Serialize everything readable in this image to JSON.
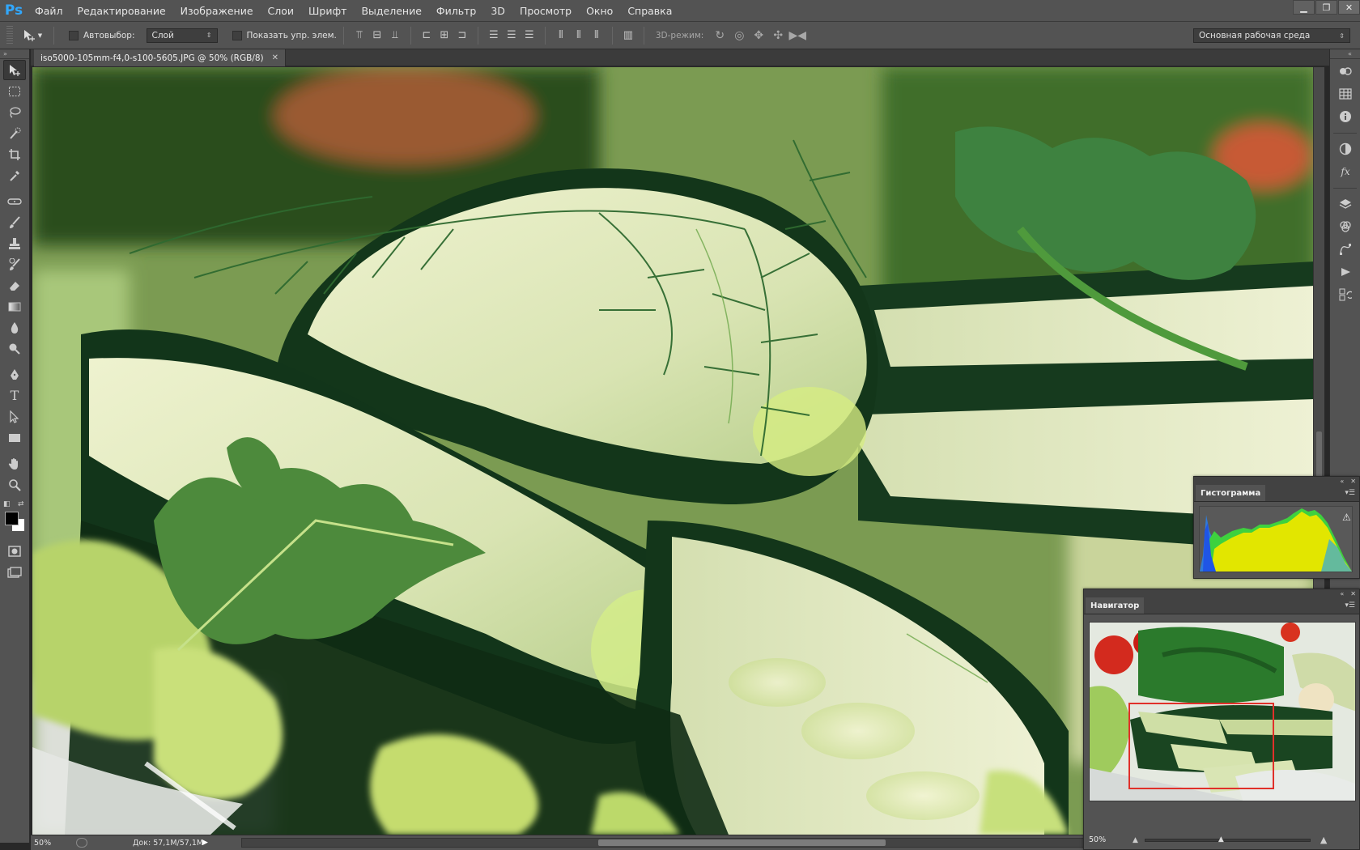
{
  "app": {
    "logo": "Ps"
  },
  "menu": [
    "Файл",
    "Редактирование",
    "Изображение",
    "Слои",
    "Шрифт",
    "Выделение",
    "Фильтр",
    "3D",
    "Просмотр",
    "Окно",
    "Справка"
  ],
  "window_controls": {
    "minimize": "▁",
    "restore": "❐",
    "close": "✕"
  },
  "options": {
    "move_tool_icon": "move-tool-icon",
    "auto_select_label": "Автовыбор:",
    "auto_select_value": "Слой",
    "show_transform_label": "Показать упр. элем.",
    "mode_3d_label": "3D-режим:",
    "workspace_value": "Основная рабочая среда"
  },
  "document": {
    "tab_title": "iso5000-105mm-f4,0-s100-5605.JPG @ 50% (RGB/8)",
    "close_glyph": "✕"
  },
  "status": {
    "zoom": "50%",
    "doc_size": "Док: 57,1M/57,1M",
    "arrow": "▶"
  },
  "histogram_panel": {
    "title": "Гистограмма",
    "warning_glyph": "⚠"
  },
  "navigator_panel": {
    "title": "Навигатор",
    "zoom": "50%",
    "view_rect_color": "#e0302a"
  },
  "colors": {
    "ui_bg": "#535353",
    "workspace_bg": "#282828",
    "foreground": "#000000",
    "background": "#ffffff"
  },
  "icons": {
    "toolbox": [
      "move-tool-icon",
      "marquee-tool-icon",
      "lasso-tool-icon",
      "quick-selection-tool-icon",
      "crop-tool-icon",
      "eyedropper-tool-icon",
      "healing-brush-tool-icon",
      "brush-tool-icon",
      "clone-stamp-tool-icon",
      "history-brush-tool-icon",
      "eraser-tool-icon",
      "gradient-tool-icon",
      "blur-tool-icon",
      "dodge-tool-icon",
      "pen-tool-icon",
      "type-tool-icon",
      "path-selection-tool-icon",
      "rectangle-tool-icon",
      "hand-tool-icon",
      "zoom-tool-icon"
    ],
    "dock": [
      "color-icon",
      "swatches-icon",
      "info-icon",
      "adjustments-icon",
      "styles-icon",
      "layers-icon",
      "channels-icon",
      "paths-icon",
      "actions-icon",
      "history-icon"
    ]
  }
}
